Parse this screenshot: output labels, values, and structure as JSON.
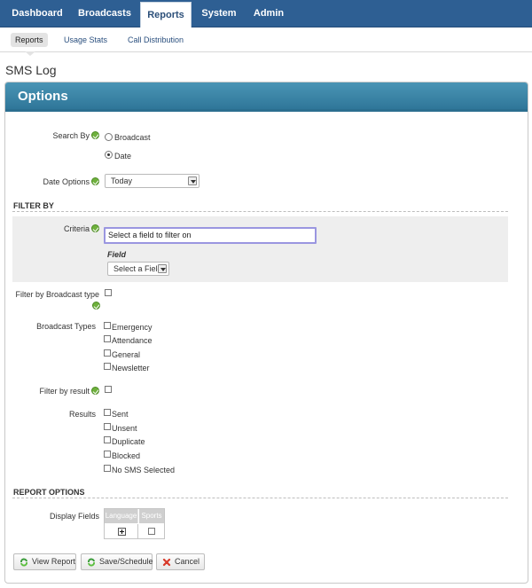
{
  "nav": {
    "tabs": [
      {
        "label": "Dashboard"
      },
      {
        "label": "Broadcasts"
      },
      {
        "label": "Reports"
      },
      {
        "label": "System"
      },
      {
        "label": "Admin"
      }
    ]
  },
  "subnav": {
    "items": [
      {
        "label": "Reports"
      },
      {
        "label": "Usage Stats"
      },
      {
        "label": "Call Distribution"
      }
    ]
  },
  "page": {
    "title": "SMS Log"
  },
  "panel": {
    "title": "Options"
  },
  "search_by": {
    "label": "Search By",
    "options": [
      {
        "label": "Broadcast",
        "checked": false
      },
      {
        "label": "Date",
        "checked": true
      }
    ]
  },
  "date_options": {
    "label": "Date Options",
    "value": "Today"
  },
  "filter_by": {
    "heading": "FILTER BY",
    "criteria_label": "Criteria",
    "criteria_value": "Select a field to filter on",
    "field_label": "Field",
    "field_select": "Select a Field"
  },
  "broadcast_type_filter": {
    "label": "Filter by Broadcast type"
  },
  "broadcast_types": {
    "label": "Broadcast Types",
    "items": [
      "Emergency",
      "Attendance",
      "General",
      "Newsletter"
    ]
  },
  "result_filter": {
    "label": "Filter by result"
  },
  "results": {
    "label": "Results",
    "items": [
      "Sent",
      "Unsent",
      "Duplicate",
      "Blocked",
      "No SMS Selected"
    ]
  },
  "report_options": {
    "heading": "REPORT OPTIONS",
    "display_fields_label": "Display Fields",
    "columns": [
      "Language",
      "Sports"
    ]
  },
  "buttons": {
    "view_report": "View Report",
    "save_schedule": "Save/Schedule",
    "cancel": "Cancel"
  },
  "colors": {
    "nav_bg": "#2e5f93",
    "panel_header": "#3a86a8",
    "help_icon": "#6fb13d",
    "cancel_icon": "#d83a2a",
    "focus_border": "#9a96e0"
  }
}
